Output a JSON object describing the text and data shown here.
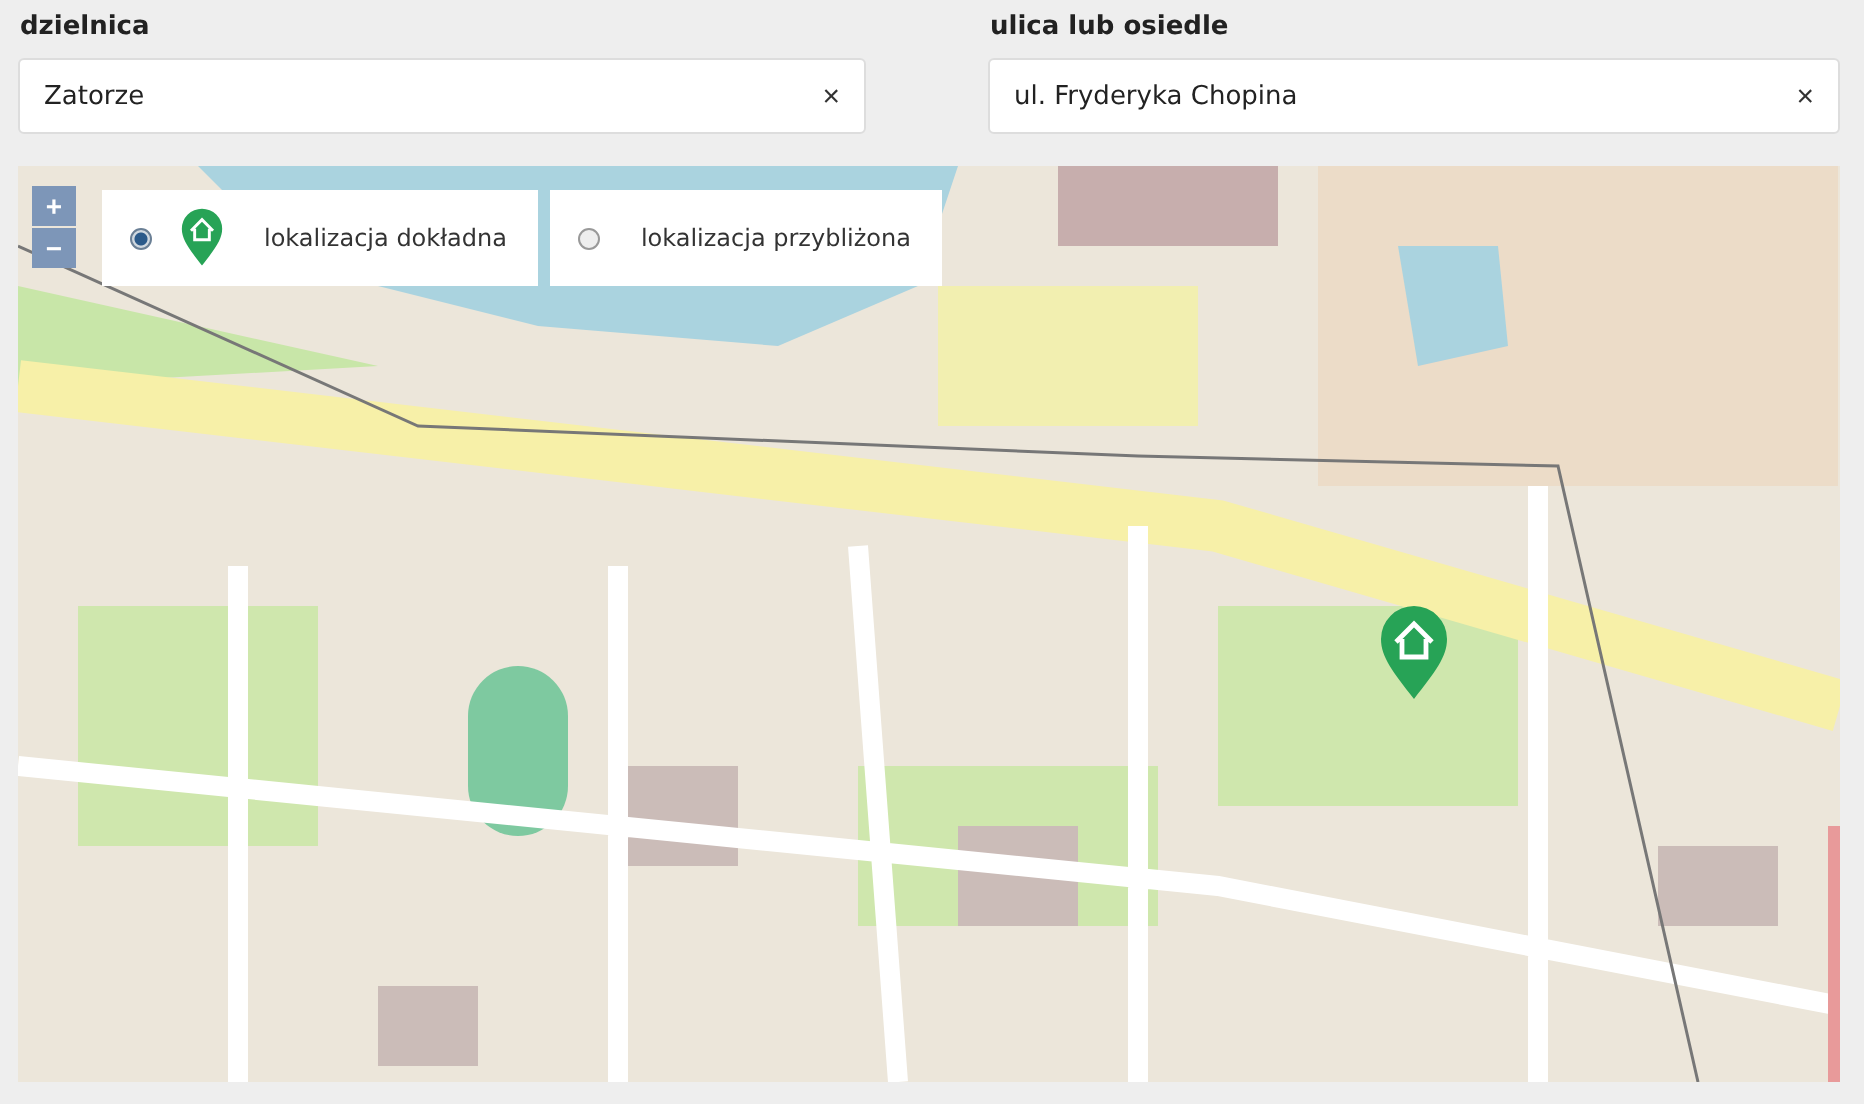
{
  "fields": [
    {
      "label": "dzielnica",
      "value": "Zatorze",
      "clear": "×"
    },
    {
      "label": "ulica lub osiedle",
      "value": "ul. Fryderyka Chopina",
      "clear": "×"
    }
  ],
  "map": {
    "zoom_controls": [
      "+",
      "−"
    ],
    "location_options": [
      {
        "label": "lokalizacja dokładna",
        "kind": "with-pin",
        "selected": true
      },
      {
        "label": "lokalizacja przybliżona",
        "kind": "plain",
        "selected": false
      }
    ]
  }
}
